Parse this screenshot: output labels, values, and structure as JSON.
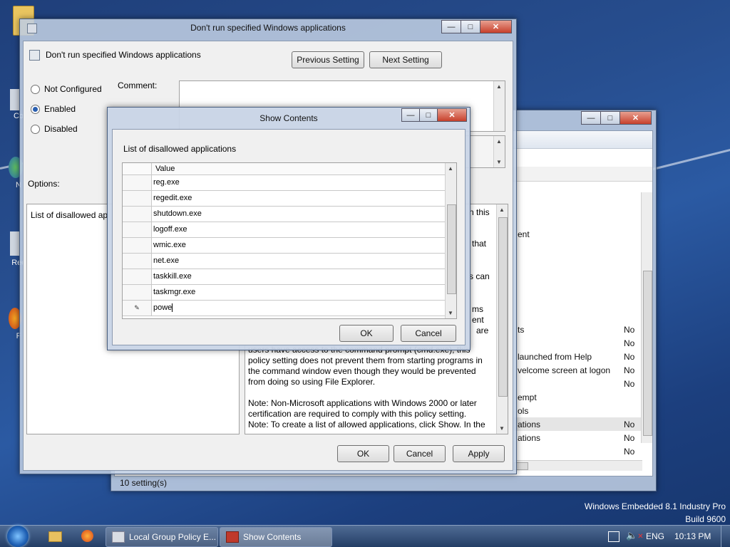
{
  "desktop": {
    "icon_labels": [
      "Co",
      "N",
      "Rec",
      "F"
    ],
    "branding": {
      "line1": "Windows Embedded 8.1 Industry Pro",
      "line2": "Build 9600"
    }
  },
  "back_window": {
    "status": "10 setting(s)",
    "visible_settings": [
      {
        "name": "ent",
        "state": ""
      },
      {
        "name": "ts",
        "state": "No"
      },
      {
        "name": "",
        "state": "No"
      },
      {
        "name": "launched from Help",
        "state": "No"
      },
      {
        "name": "velcome screen at logon",
        "state": "No"
      },
      {
        "name": "",
        "state": "No"
      },
      {
        "name": "empt",
        "state": ""
      },
      {
        "name": "ols",
        "state": ""
      },
      {
        "name": "ations",
        "state": "No"
      },
      {
        "name": "ations",
        "state": "No"
      },
      {
        "name": "",
        "state": "No"
      }
    ]
  },
  "policy_window": {
    "title": "Don't run specified Windows applications",
    "heading": "Don't run specified Windows applications",
    "prev_setting": "Previous Setting",
    "next_setting": "Next Setting",
    "comment_label": "Comment:",
    "radios": [
      {
        "label": "Not Configured",
        "selected": false
      },
      {
        "label": "Enabled",
        "selected": true
      },
      {
        "label": "Disabled",
        "selected": false
      }
    ],
    "options_label": "Options:",
    "options_text": "List of disallowed ap",
    "help_fragments": [
      "n this",
      "that",
      "s can",
      "ms",
      "ent",
      "are"
    ],
    "help_lines": [
      "users have access to the command prompt (cmd.exe), this",
      "policy setting does not prevent them from starting programs in",
      "the command window even though they would be prevented",
      "from doing so using File Explorer.",
      "",
      "Note: Non-Microsoft applications with Windows 2000 or later",
      "certification are required to comply with this policy setting.",
      "Note: To create a list of allowed applications, click Show.  In the"
    ],
    "ok": "OK",
    "cancel": "Cancel",
    "apply": "Apply"
  },
  "show_contents": {
    "title": "Show Contents",
    "list_label": "List of disallowed applications",
    "column_header": "Value",
    "rows": [
      "reg.exe",
      "regedit.exe",
      "shutdown.exe",
      "logoff.exe",
      "wmic.exe",
      "net.exe",
      "taskkill.exe",
      "taskmgr.exe",
      "powe"
    ],
    "edit_marker": "✎",
    "ok": "OK",
    "cancel": "Cancel"
  },
  "taskbar": {
    "items": [
      "Local Group Policy E...",
      "Show Contents"
    ],
    "language": "ENG",
    "time": "10:13 PM"
  },
  "colors": {
    "accent": "#2a5fb0",
    "close_button": "#c7402c",
    "taskbar": "#243e66"
  }
}
